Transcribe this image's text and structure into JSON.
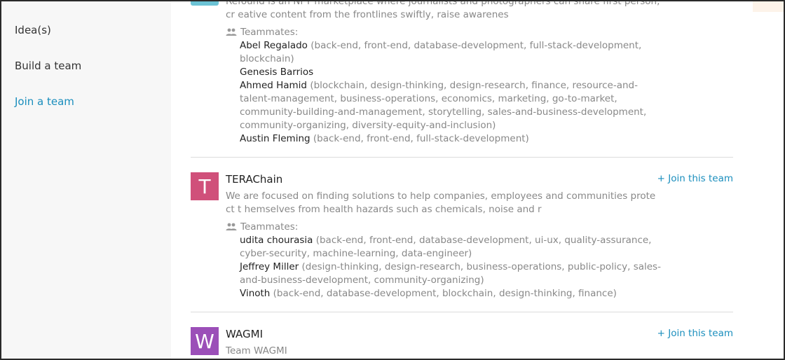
{
  "sidebar": {
    "items": [
      {
        "label": "Idea(s)",
        "active": false
      },
      {
        "label": "Build a team",
        "active": false
      },
      {
        "label": "Join a team",
        "active": true
      }
    ]
  },
  "teams": [
    {
      "description": "Refound is an NFT marketplace where journalists and photographers can share first person, cr eative content from the frontlines swiftly, raise awarenes",
      "teammates_label": "Teammates:",
      "members": [
        {
          "name": "Abel Regalado",
          "skills": "(back-end, front-end, database-development, full-stack-development, blockchain)"
        },
        {
          "name": "Genesis Barrios",
          "skills": ""
        },
        {
          "name": "Ahmed Hamid",
          "skills": "(blockchain, design-thinking, design-research, finance, resource-and-talent-management, business-operations, economics, marketing, go-to-market, community-building-and-management, storytelling, sales-and-business-development, community-organizing, diversity-equity-and-inclusion)"
        },
        {
          "name": "Austin Fleming",
          "skills": "(back-end, front-end, full-stack-development)"
        }
      ]
    },
    {
      "avatar_letter": "T",
      "avatar_color": "#d0507a",
      "name": "TERAChain",
      "join_label": "+ Join this team",
      "description": "We are focused on finding solutions to help companies, employees and communities protect t hemselves from health hazards such as chemicals, noise and r",
      "teammates_label": "Teammates:",
      "members": [
        {
          "name": "udita chourasia",
          "skills": "(back-end, front-end, database-development, ui-ux, quality-assurance, cyber-security, machine-learning, data-engineer)"
        },
        {
          "name": "Jeffrey Miller",
          "skills": "(design-thinking, design-research, business-operations, public-policy, sales-and-business-development, community-organizing)"
        },
        {
          "name": "Vinoth",
          "skills": "(back-end, database-development, blockchain, design-thinking, finance)"
        }
      ]
    },
    {
      "avatar_letter": "W",
      "avatar_color": "#9b4fb8",
      "name": "WAGMI",
      "join_label": "+ Join this team",
      "description": "Team WAGMI"
    }
  ]
}
